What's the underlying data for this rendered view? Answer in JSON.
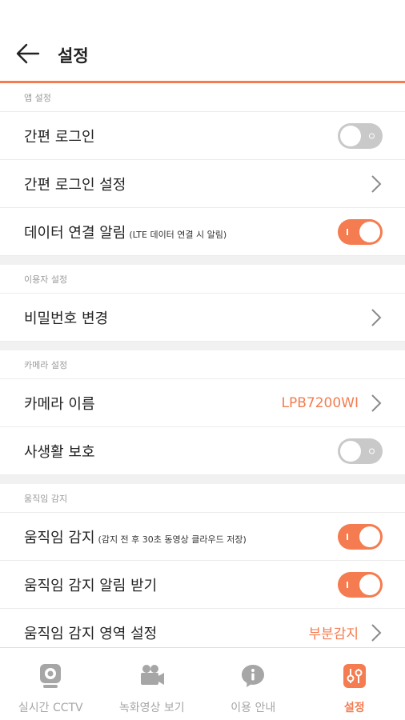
{
  "header": {
    "title": "설정"
  },
  "sections": {
    "app": {
      "title": "앱 설정",
      "easy_login": {
        "label": "간편 로그인",
        "enabled": false
      },
      "easy_login_settings": {
        "label": "간편 로그인 설정"
      },
      "data_alert": {
        "label": "데이터 연결 알림",
        "sub": "(LTE 데이터 연결 시 알림)",
        "enabled": true
      }
    },
    "user": {
      "title": "이용자 설정",
      "change_password": {
        "label": "비밀번호 변경"
      }
    },
    "camera": {
      "title": "카메라 설정",
      "camera_name": {
        "label": "카메라 이름",
        "value": "LPB7200WI"
      },
      "privacy": {
        "label": "사생활 보호",
        "enabled": false
      }
    },
    "motion": {
      "title": "움직임 감지",
      "motion_detect": {
        "label": "움직임 감지",
        "sub": "(감지 전 후 30초 동영상 클라우드 저장)",
        "enabled": true
      },
      "motion_alert": {
        "label": "움직임 감지 알림 받기",
        "enabled": true
      },
      "motion_area": {
        "label": "움직임 감지 영역 설정",
        "value": "부분감지"
      }
    }
  },
  "tabbar": {
    "live": "실시간 CCTV",
    "recording": "녹화영상 보기",
    "guide": "이용 안내",
    "settings": "설정",
    "active": "settings"
  },
  "colors": {
    "accent": "#f47c50",
    "toggle_off": "#c9c9c9",
    "inactive_tab": "#a6a6a6"
  }
}
